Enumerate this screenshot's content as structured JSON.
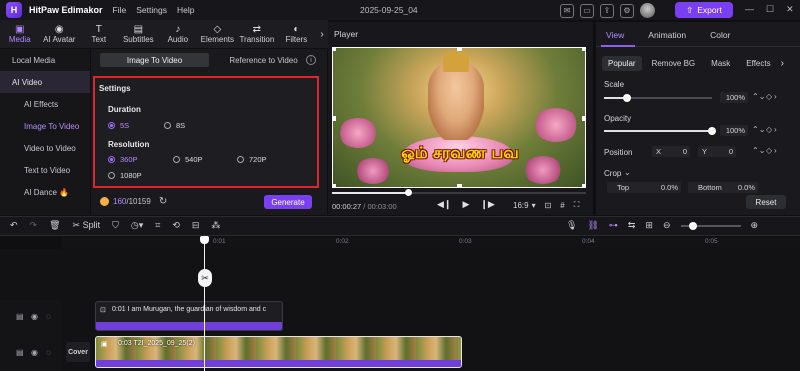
{
  "app": {
    "name": "HitPaw Edimakor",
    "project_title": "2025-09-25_04",
    "export_label": "Export"
  },
  "menu": [
    "File",
    "Settings",
    "Help"
  ],
  "toolbar": {
    "items": [
      "Media",
      "AI Avatar",
      "Text",
      "Subtitles",
      "Audio",
      "Elements",
      "Transition",
      "Filters"
    ],
    "active": "Media"
  },
  "sidebar": {
    "items": [
      {
        "label": "Local Media"
      },
      {
        "label": "AI Video"
      },
      {
        "label": "AI Effects"
      },
      {
        "label": "Image To Video"
      },
      {
        "label": "Video to Video"
      },
      {
        "label": "Text to Video"
      },
      {
        "label": "AI Dance 🔥"
      }
    ]
  },
  "mid": {
    "tabs": [
      "Image To Video",
      "Reference to Video"
    ],
    "settings_title": "Settings",
    "duration_label": "Duration",
    "durations": [
      "5S",
      "8S"
    ],
    "resolution_label": "Resolution",
    "resolutions": [
      "360P",
      "540P",
      "720P",
      "1080P"
    ],
    "credits_used": "160",
    "credits_total": "/10159",
    "generate_label": "Generate"
  },
  "player": {
    "title": "Player",
    "caption": "ஓம் சரவண பவ",
    "current_time": "00:00:27",
    "total_time": "/ 00:03:00",
    "aspect": "16:9",
    "progress_fraction": 0.3
  },
  "right": {
    "tabs": [
      "View",
      "Animation",
      "Color"
    ],
    "subtabs": [
      "Popular",
      "Remove BG",
      "Mask",
      "Effects"
    ],
    "scale_label": "Scale",
    "scale_value": "100%",
    "opacity_label": "Opacity",
    "opacity_value": "100%",
    "position_label": "Position",
    "x_label": "X",
    "x_value": "0",
    "y_label": "Y",
    "y_value": "0",
    "crop_label": "Crop",
    "top_label": "Top",
    "top_value": "0.0%",
    "bottom_label": "Bottom",
    "bottom_value": "0.0%",
    "reset_label": "Reset"
  },
  "timeline": {
    "split_label": "Split",
    "ticks": [
      "0:01",
      "0:02",
      "0:03",
      "0:04",
      "0:05"
    ],
    "text_clip": "0:01 I am Murugan, the guardian of wisdom and c",
    "video_clip": "0:03 T2I_2025_09_25(2)",
    "cover_label": "Cover"
  }
}
